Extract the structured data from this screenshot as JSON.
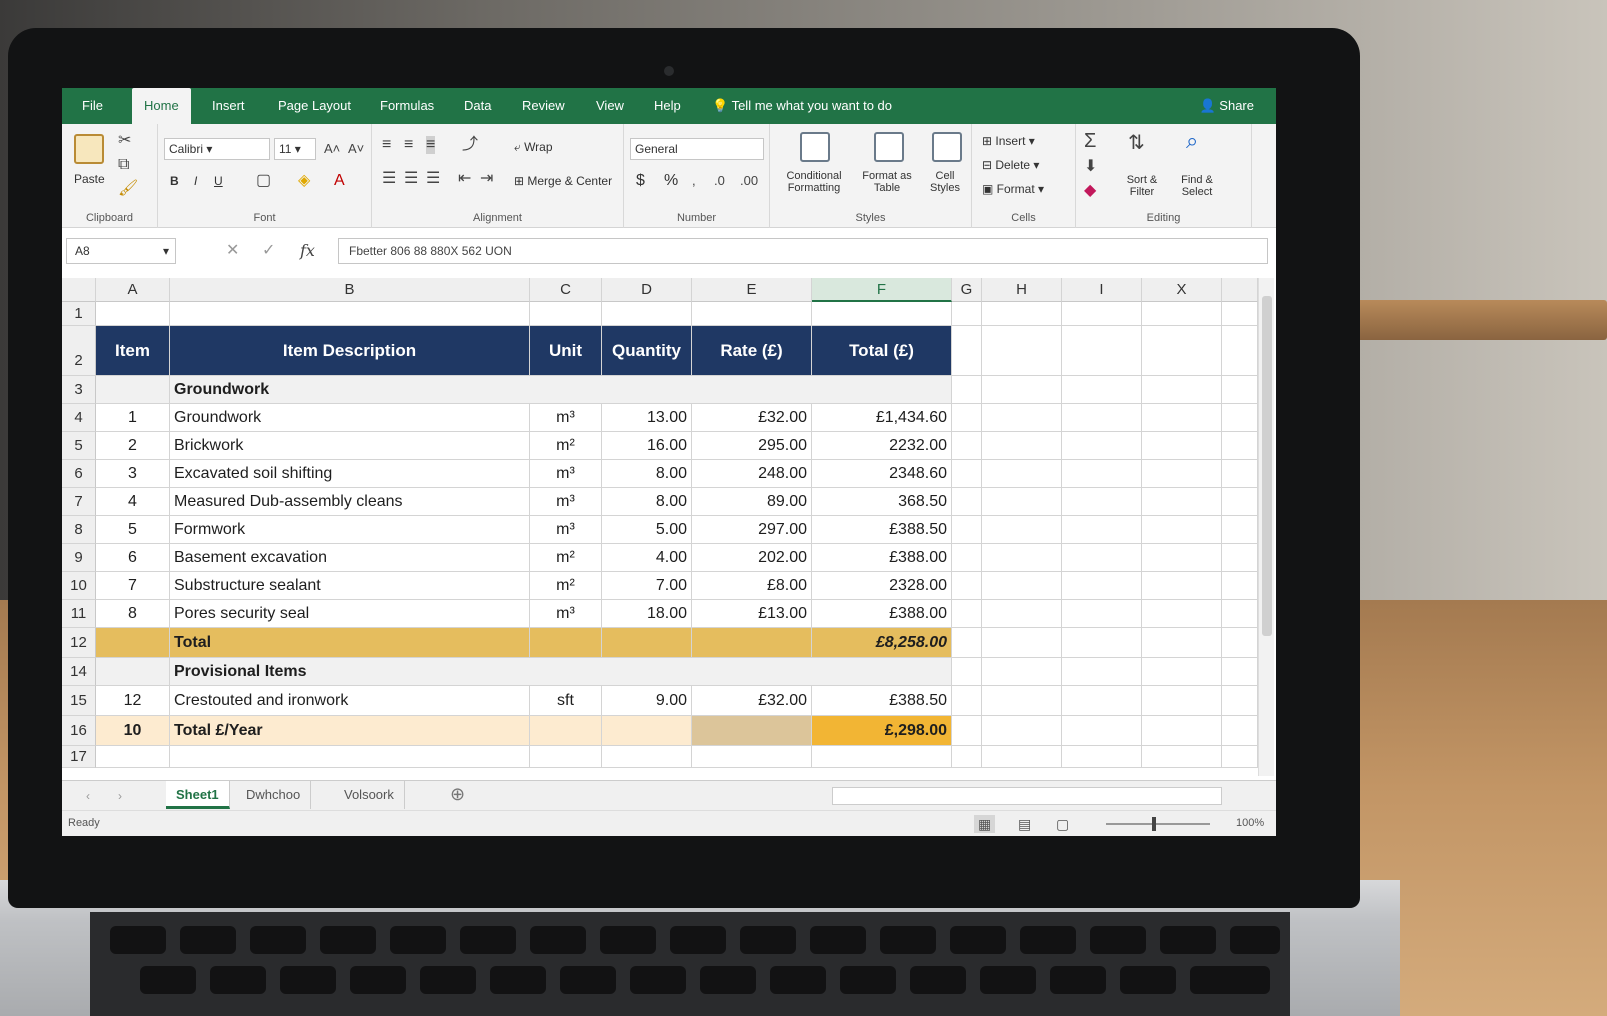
{
  "ribbon_tabs": [
    "File",
    "Home",
    "Insert",
    "Page Layout",
    "Formulas",
    "Data",
    "Review",
    "View",
    "Help"
  ],
  "active_tab": "Home",
  "tell_me": "Tell me what you want to do",
  "share": "Share",
  "clipboard": {
    "paste": "Paste",
    "label": "Clipboard"
  },
  "font": {
    "name": "Calibri",
    "size": "11",
    "label": "Font",
    "bold": "B",
    "italic": "I",
    "underline": "U"
  },
  "alignment": {
    "wrap": "Wrap",
    "merge": "Merge & Center",
    "label": "Alignment"
  },
  "number": {
    "format": "General",
    "currency": "$",
    "percent": "%",
    "label": "Number"
  },
  "styles": {
    "conditional": "Conditional Formatting",
    "format_as": "Format as Table",
    "cell_styles": "Cell Styles",
    "label": "Styles"
  },
  "cells": {
    "insert": "Insert",
    "delete": "Delete",
    "format": "Format",
    "label": "Cells"
  },
  "editing": {
    "sort": "Sort & Filter",
    "find": "Find & Select",
    "label": "Editing"
  },
  "name_box": "A8",
  "formula": "Fbetter 806 88 880X 562 UON",
  "columns": [
    "A",
    "B",
    "C",
    "D",
    "E",
    "F",
    "G",
    "H",
    "I",
    "X"
  ],
  "row_numbers": [
    "1",
    "2",
    "3",
    "4",
    "5",
    "6",
    "7",
    "8",
    "9",
    "10",
    "11",
    "12",
    "14",
    "15",
    "16",
    "17"
  ],
  "table_header": [
    "Item",
    "Item Description",
    "Unit",
    "Quantity",
    "Rate (£)",
    "Total (£)"
  ],
  "section1": "Groundwork",
  "rows": [
    {
      "item": "1",
      "desc": "Groundwork",
      "unit": "m³",
      "qty": "13.00",
      "rate": "£32.00",
      "total": "£1,434.60"
    },
    {
      "item": "2",
      "desc": "Brickwork",
      "unit": "m²",
      "qty": "16.00",
      "rate": "295.00",
      "total": "2232.00"
    },
    {
      "item": "3",
      "desc": "Excavated soil shifting",
      "unit": "m³",
      "qty": "8.00",
      "rate": "248.00",
      "total": "2348.60"
    },
    {
      "item": "4",
      "desc": "Measured Dub-assembly cleans",
      "unit": "m³",
      "qty": "8.00",
      "rate": "89.00",
      "total": "368.50"
    },
    {
      "item": "5",
      "desc": "Formwork",
      "unit": "m³",
      "qty": "5.00",
      "rate": "297.00",
      "total": "£388.50"
    },
    {
      "item": "6",
      "desc": "Basement excavation",
      "unit": "m²",
      "qty": "4.00",
      "rate": "202.00",
      "total": "£388.00"
    },
    {
      "item": "7",
      "desc": "Substructure sealant",
      "unit": "m²",
      "qty": "7.00",
      "rate": "£8.00",
      "total": "2328.00"
    },
    {
      "item": "8",
      "desc": "Pores security seal",
      "unit": "m³",
      "qty": "18.00",
      "rate": "£13.00",
      "total": "£388.00"
    }
  ],
  "total_row": {
    "label": "Total",
    "value": "£8,258.00"
  },
  "section2": "Provisional Items",
  "row15": {
    "item": "12",
    "desc": "Crestouted and ironwork",
    "unit": "sft",
    "qty": "9.00",
    "rate": "£32.00",
    "total": "£388.50"
  },
  "row16": {
    "item": "10",
    "desc": "Total £/Year",
    "total": "£,298.00"
  },
  "sheets": [
    "Sheet1",
    "Dwhchoo",
    "Volsoork"
  ],
  "status": "Ready",
  "zoom": "100%"
}
